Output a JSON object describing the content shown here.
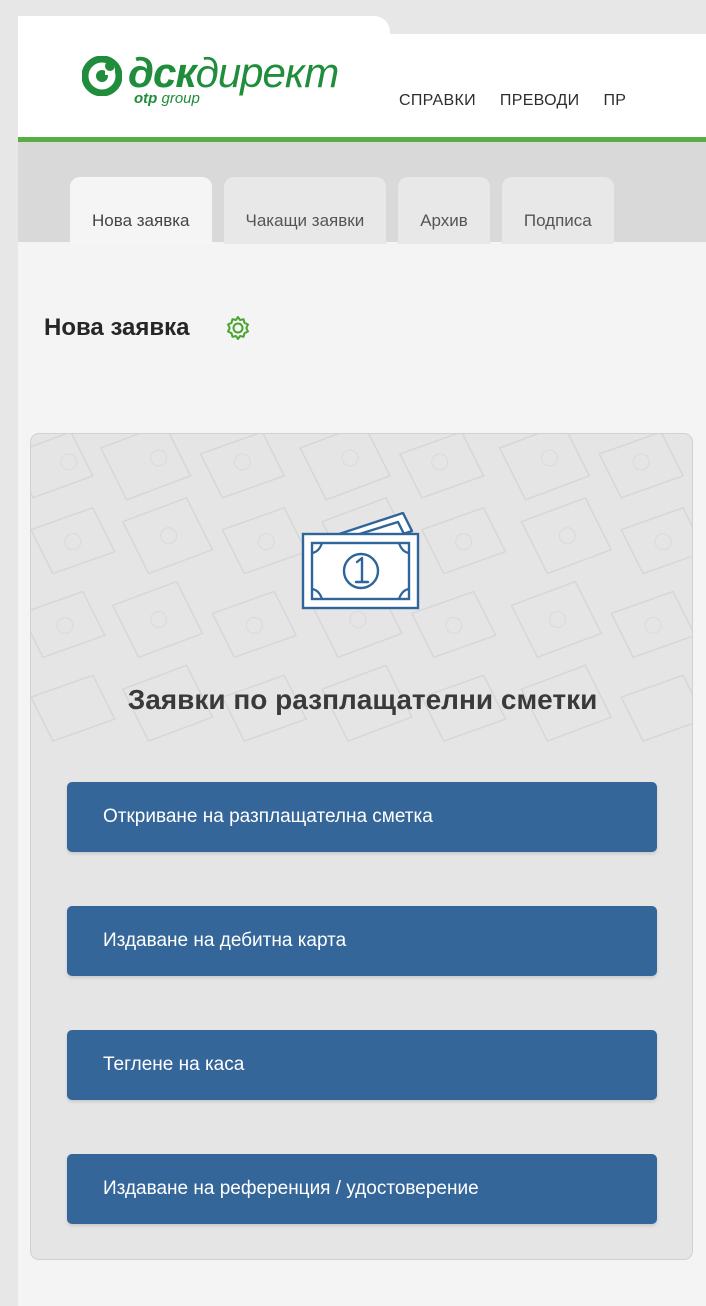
{
  "brand": {
    "logo_strong": "дск",
    "logo_light": "директ",
    "logo_sub_strong": "otp",
    "logo_sub_light": "group"
  },
  "top_nav": {
    "items": [
      "СПРАВКИ",
      "ПРЕВОДИ",
      "ПР"
    ]
  },
  "subtabs": {
    "items": [
      "Нова заявка",
      "Чакащи заявки",
      "Архив",
      "Подписа"
    ]
  },
  "page": {
    "title": "Нова заявка"
  },
  "panel": {
    "title": "Заявки по разплащателни сметки",
    "icon": "money-note-icon",
    "actions": [
      "Откриване на разплащателна сметка",
      "Издаване на дебитна карта",
      "Теглене на каса",
      "Издаване на референция / удостоверение"
    ]
  },
  "colors": {
    "brand_green": "#1f8d3b",
    "header_line": "#57ad41",
    "button_blue": "#356699"
  }
}
